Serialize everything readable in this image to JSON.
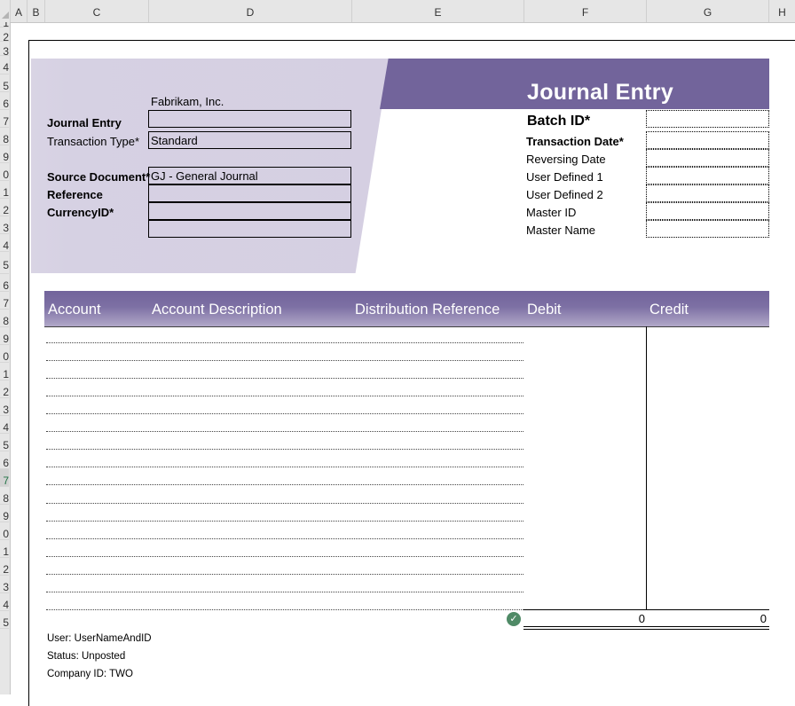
{
  "spreadsheet": {
    "columns": [
      "A",
      "B",
      "C",
      "D",
      "E",
      "F",
      "G",
      "H"
    ],
    "rows": [
      "1",
      "2",
      "3",
      "4",
      "5",
      "6",
      "7",
      "8",
      "9",
      "0",
      "1",
      "2",
      "3",
      "4",
      "5",
      "6",
      "7",
      "8",
      "9",
      "0",
      "1",
      "2",
      "3",
      "4",
      "5",
      "6",
      "7",
      "8",
      "9",
      "0",
      "1",
      "2",
      "3",
      "4",
      "5"
    ]
  },
  "header": {
    "company": "Fabrikam, Inc.",
    "title": "Journal Entry",
    "left_fields": [
      {
        "label": "Journal Entry",
        "value": ""
      },
      {
        "label": "Transaction Type*",
        "value": "Standard"
      },
      {
        "label": "Source Document*",
        "value": "GJ - General Journal"
      },
      {
        "label": "Reference",
        "value": ""
      },
      {
        "label": "CurrencyID*",
        "value": ""
      },
      {
        "label": "",
        "value": ""
      }
    ],
    "right_fields": [
      {
        "label": "Batch ID*",
        "value": ""
      },
      {
        "label": "Transaction Date*",
        "value": ""
      },
      {
        "label": "Reversing Date",
        "value": ""
      },
      {
        "label": "User Defined 1",
        "value": ""
      },
      {
        "label": "User Defined 2",
        "value": ""
      },
      {
        "label": "Master ID",
        "value": ""
      },
      {
        "label": "Master Name",
        "value": ""
      }
    ]
  },
  "grid": {
    "columns": [
      "Account",
      "Account Description",
      "Distribution Reference",
      "Debit",
      "Credit"
    ],
    "line_count": 16,
    "debit_total": "0",
    "credit_total": "0",
    "status_icon": "check-circle-icon",
    "accent_color": "#72649b"
  },
  "footer": {
    "user": "User: UserNameAndID",
    "status": "Status: Unposted",
    "company_id": "Company ID: TWO"
  }
}
